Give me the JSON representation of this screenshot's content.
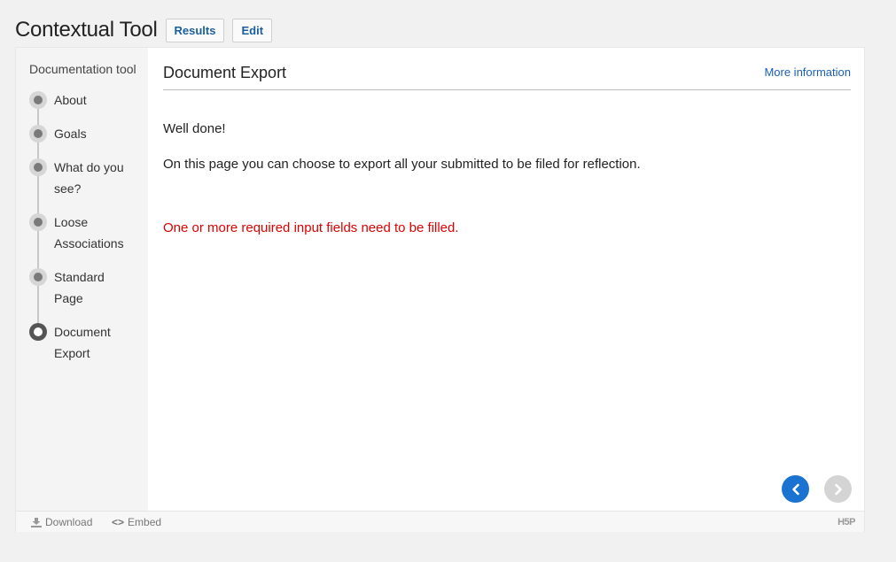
{
  "header": {
    "title": "Contextual Tool",
    "results_label": "Results",
    "edit_label": "Edit"
  },
  "sidebar": {
    "title": "Documentation tool",
    "items": [
      {
        "label": "About"
      },
      {
        "label": "Goals"
      },
      {
        "label": "What do you see?"
      },
      {
        "label": "Loose Associations"
      },
      {
        "label": "Standard Page"
      },
      {
        "label": "Document Export"
      }
    ],
    "current_index": 5
  },
  "main": {
    "title": "Document Export",
    "more_info": "More information",
    "paragraph1": "Well done!",
    "paragraph2": "On this page you can choose to export all your submitted to be filed for reflection.",
    "error": "One or more required input fields need to be filled."
  },
  "footer": {
    "download": "Download",
    "embed": "Embed",
    "embed_glyph": "<>",
    "brand": "H5P"
  },
  "colors": {
    "accent": "#1b73d1",
    "error": "#e00000",
    "link": "#1a5fb4"
  }
}
